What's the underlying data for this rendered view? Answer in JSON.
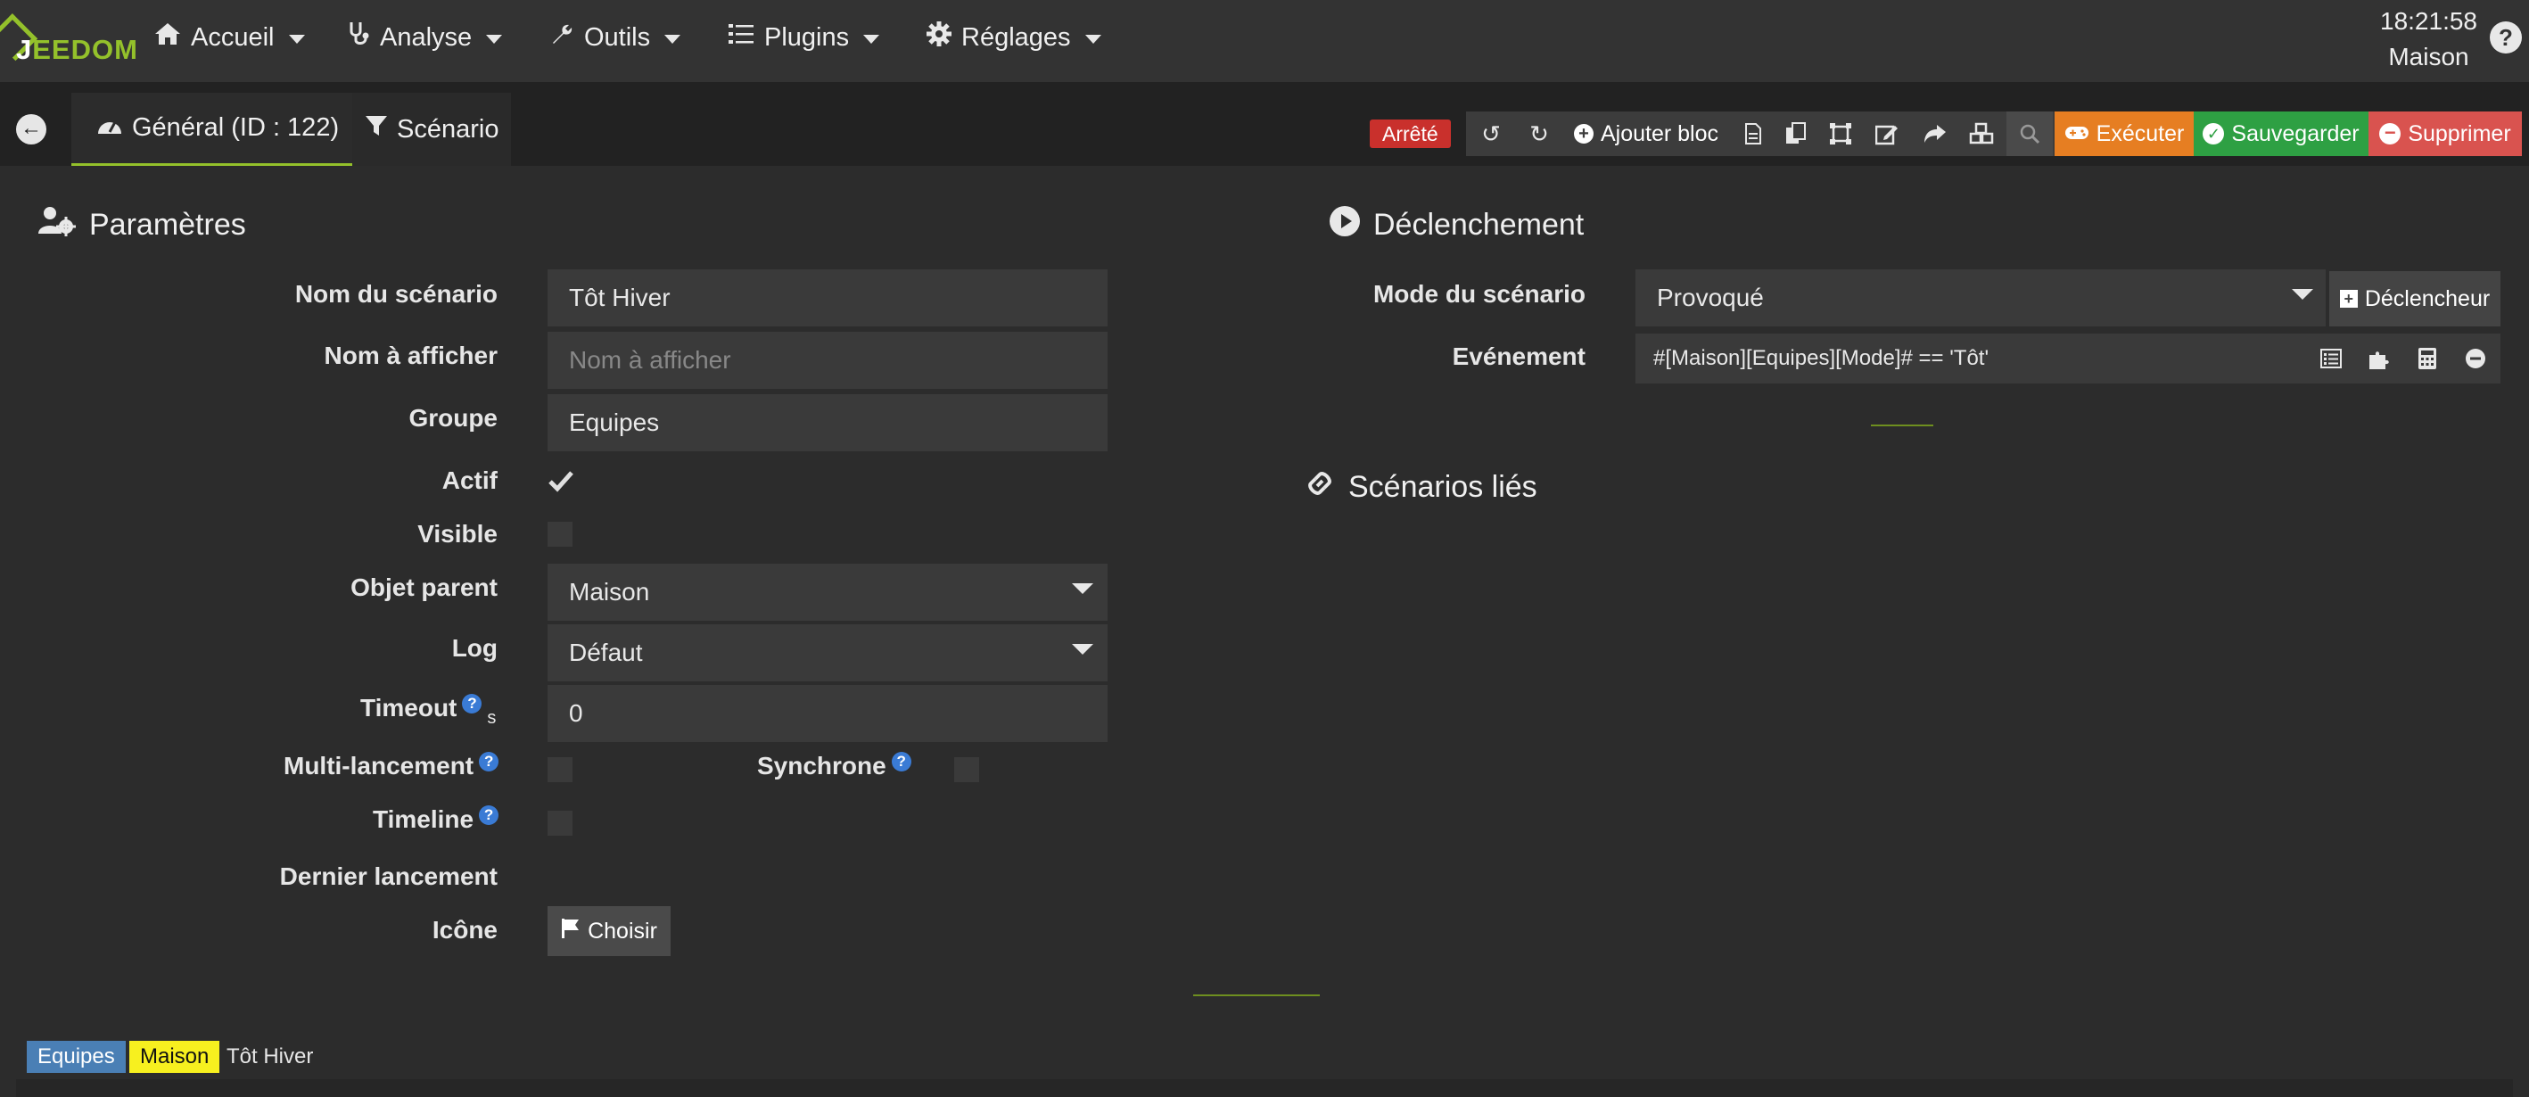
{
  "brand": {
    "logo_prefix": "J",
    "logo_text": "EEDOM"
  },
  "nav": {
    "items": [
      {
        "label": "Accueil",
        "icon": "home-icon"
      },
      {
        "label": "Analyse",
        "icon": "stethoscope-icon"
      },
      {
        "label": "Outils",
        "icon": "wrench-icon"
      },
      {
        "label": "Plugins",
        "icon": "list-icon"
      },
      {
        "label": "Réglages",
        "icon": "gear-icon"
      }
    ],
    "time": "18:21:58",
    "location": "Maison",
    "help": "?"
  },
  "tabs": {
    "general": "Général (ID : 122)",
    "scenario": "Scénario"
  },
  "toolbar": {
    "status": "Arrêté",
    "add_block": "Ajouter bloc",
    "execute": "Exécuter",
    "save": "Sauvegarder",
    "delete": "Supprimer",
    "colors": {
      "status": "#c9302c",
      "execute": "#e67e22",
      "save": "#2ea043",
      "delete": "#d9534f"
    }
  },
  "params": {
    "title": "Paramètres",
    "labels": {
      "name": "Nom du scénario",
      "display_name": "Nom à afficher",
      "group": "Groupe",
      "active": "Actif",
      "visible": "Visible",
      "parent": "Objet parent",
      "log": "Log",
      "timeout": "Timeout",
      "timeout_unit": "s",
      "multi": "Multi-lancement",
      "sync": "Synchrone",
      "timeline": "Timeline",
      "last_run": "Dernier lancement",
      "icon": "Icône"
    },
    "values": {
      "name": "Tôt Hiver",
      "display_name_placeholder": "Nom à afficher",
      "group": "Equipes",
      "parent": "Maison",
      "log": "Défaut",
      "timeout": "0",
      "active": true,
      "visible": false,
      "multi": false,
      "sync": false,
      "timeline": false
    },
    "choose_button": "Choisir"
  },
  "trigger": {
    "title": "Déclenchement",
    "mode_label": "Mode du scénario",
    "mode_value": "Provoqué",
    "trigger_button": "Déclencheur",
    "event_label": "Evénement",
    "event_value": "#[Maison][Equipes][Mode]#  == 'Tôt'"
  },
  "linked": {
    "title": "Scénarios liés"
  },
  "footer_tags": {
    "group": "Equipes",
    "parent": "Maison",
    "name": "Tôt Hiver",
    "colors": {
      "group": "#4a7fb5",
      "parent": "#f7f01f"
    }
  }
}
